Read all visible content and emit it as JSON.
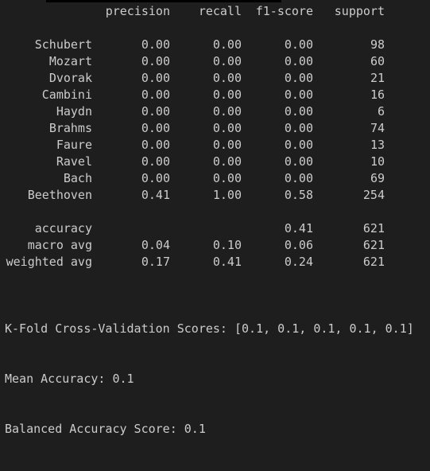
{
  "report": {
    "headers": {
      "precision": "precision",
      "recall": "recall",
      "f1": "f1-score",
      "support": "support"
    },
    "classes": [
      {
        "label": "Schubert",
        "precision": "0.00",
        "recall": "0.00",
        "f1": "0.00",
        "support": "98"
      },
      {
        "label": "Mozart",
        "precision": "0.00",
        "recall": "0.00",
        "f1": "0.00",
        "support": "60"
      },
      {
        "label": "Dvorak",
        "precision": "0.00",
        "recall": "0.00",
        "f1": "0.00",
        "support": "21"
      },
      {
        "label": "Cambini",
        "precision": "0.00",
        "recall": "0.00",
        "f1": "0.00",
        "support": "16"
      },
      {
        "label": "Haydn",
        "precision": "0.00",
        "recall": "0.00",
        "f1": "0.00",
        "support": "6"
      },
      {
        "label": "Brahms",
        "precision": "0.00",
        "recall": "0.00",
        "f1": "0.00",
        "support": "74"
      },
      {
        "label": "Faure",
        "precision": "0.00",
        "recall": "0.00",
        "f1": "0.00",
        "support": "13"
      },
      {
        "label": "Ravel",
        "precision": "0.00",
        "recall": "0.00",
        "f1": "0.00",
        "support": "10"
      },
      {
        "label": "Bach",
        "precision": "0.00",
        "recall": "0.00",
        "f1": "0.00",
        "support": "69"
      },
      {
        "label": "Beethoven",
        "precision": "0.41",
        "recall": "1.00",
        "f1": "0.58",
        "support": "254"
      }
    ],
    "summary": [
      {
        "label": "accuracy",
        "precision": "",
        "recall": "",
        "f1": "0.41",
        "support": "621"
      },
      {
        "label": "macro avg",
        "precision": "0.04",
        "recall": "0.10",
        "f1": "0.06",
        "support": "621"
      },
      {
        "label": "weighted avg",
        "precision": "0.17",
        "recall": "0.41",
        "f1": "0.24",
        "support": "621"
      }
    ]
  },
  "footer": {
    "kfold_line": "K-Fold Cross-Validation Scores: [0.1, 0.1, 0.1, 0.1, 0.1]",
    "mean_line": "Mean Accuracy: 0.1",
    "balanced_line": "Balanced Accuracy Score: 0.1"
  },
  "colors": {
    "background": "#1e1e1e",
    "text": "#cccccc",
    "redaction": "#000000"
  }
}
